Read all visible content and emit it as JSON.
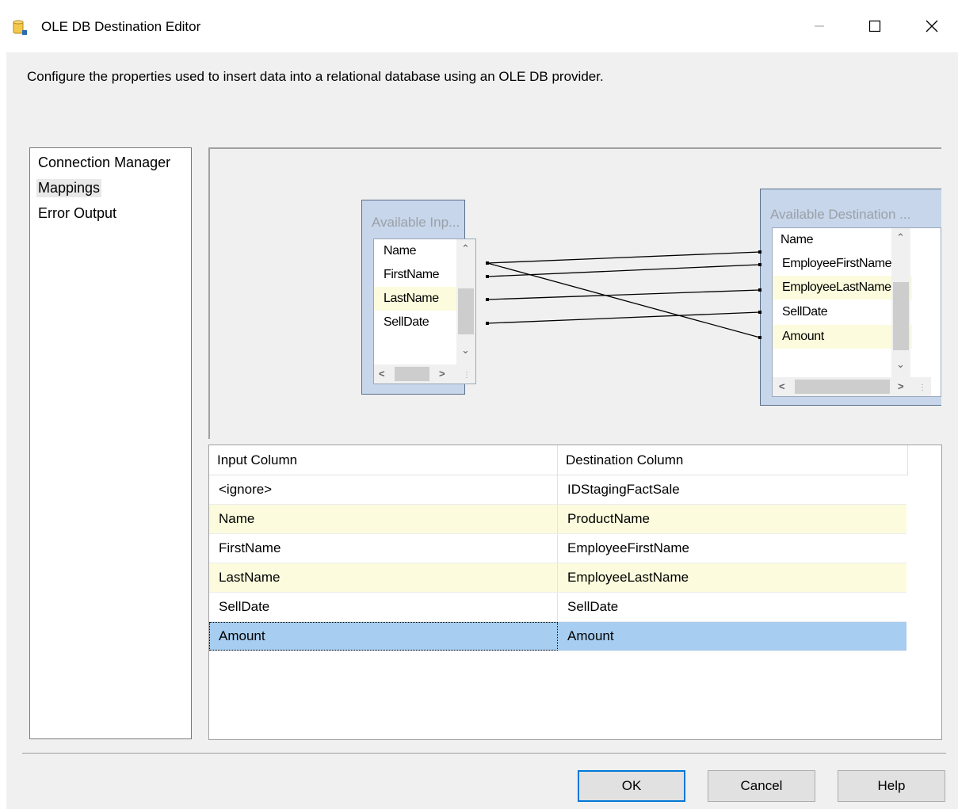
{
  "window": {
    "title": "OLE DB Destination Editor"
  },
  "description": "Configure the properties used to insert data into a relational database using an OLE DB provider.",
  "nav": {
    "items": [
      {
        "label": "Connection Manager",
        "selected": false
      },
      {
        "label": "Mappings",
        "selected": true
      },
      {
        "label": "Error Output",
        "selected": false
      }
    ]
  },
  "diagram": {
    "input_table": {
      "title": "Available Inp...",
      "columns": [
        "Name",
        "FirstName",
        "LastName",
        "SellDate"
      ],
      "highlighted": "LastName"
    },
    "dest_table": {
      "title": "Available Destination ...",
      "columns": [
        "Name",
        "EmployeeFirstName",
        "EmployeeLastName",
        "SellDate",
        "Amount"
      ],
      "highlighted": [
        "EmployeeLastName",
        "Amount"
      ]
    }
  },
  "grid": {
    "headers": [
      "Input Column",
      "Destination Column"
    ],
    "rows": [
      {
        "input": "<ignore>",
        "dest": "IDStagingFactSale",
        "state": "normal"
      },
      {
        "input": "Name",
        "dest": "ProductName",
        "state": "highlight"
      },
      {
        "input": "FirstName",
        "dest": "EmployeeFirstName",
        "state": "normal"
      },
      {
        "input": "LastName",
        "dest": "EmployeeLastName",
        "state": "highlight"
      },
      {
        "input": "SellDate",
        "dest": "SellDate",
        "state": "normal"
      },
      {
        "input": "Amount",
        "dest": "Amount",
        "state": "selected"
      }
    ]
  },
  "buttons": {
    "ok": "OK",
    "cancel": "Cancel",
    "help": "Help"
  },
  "colors": {
    "highlight_row": "#fcfbdd",
    "selected_row": "#a7cdf0",
    "default_button_border": "#0078d7",
    "table_box": "#c7d6ea"
  }
}
